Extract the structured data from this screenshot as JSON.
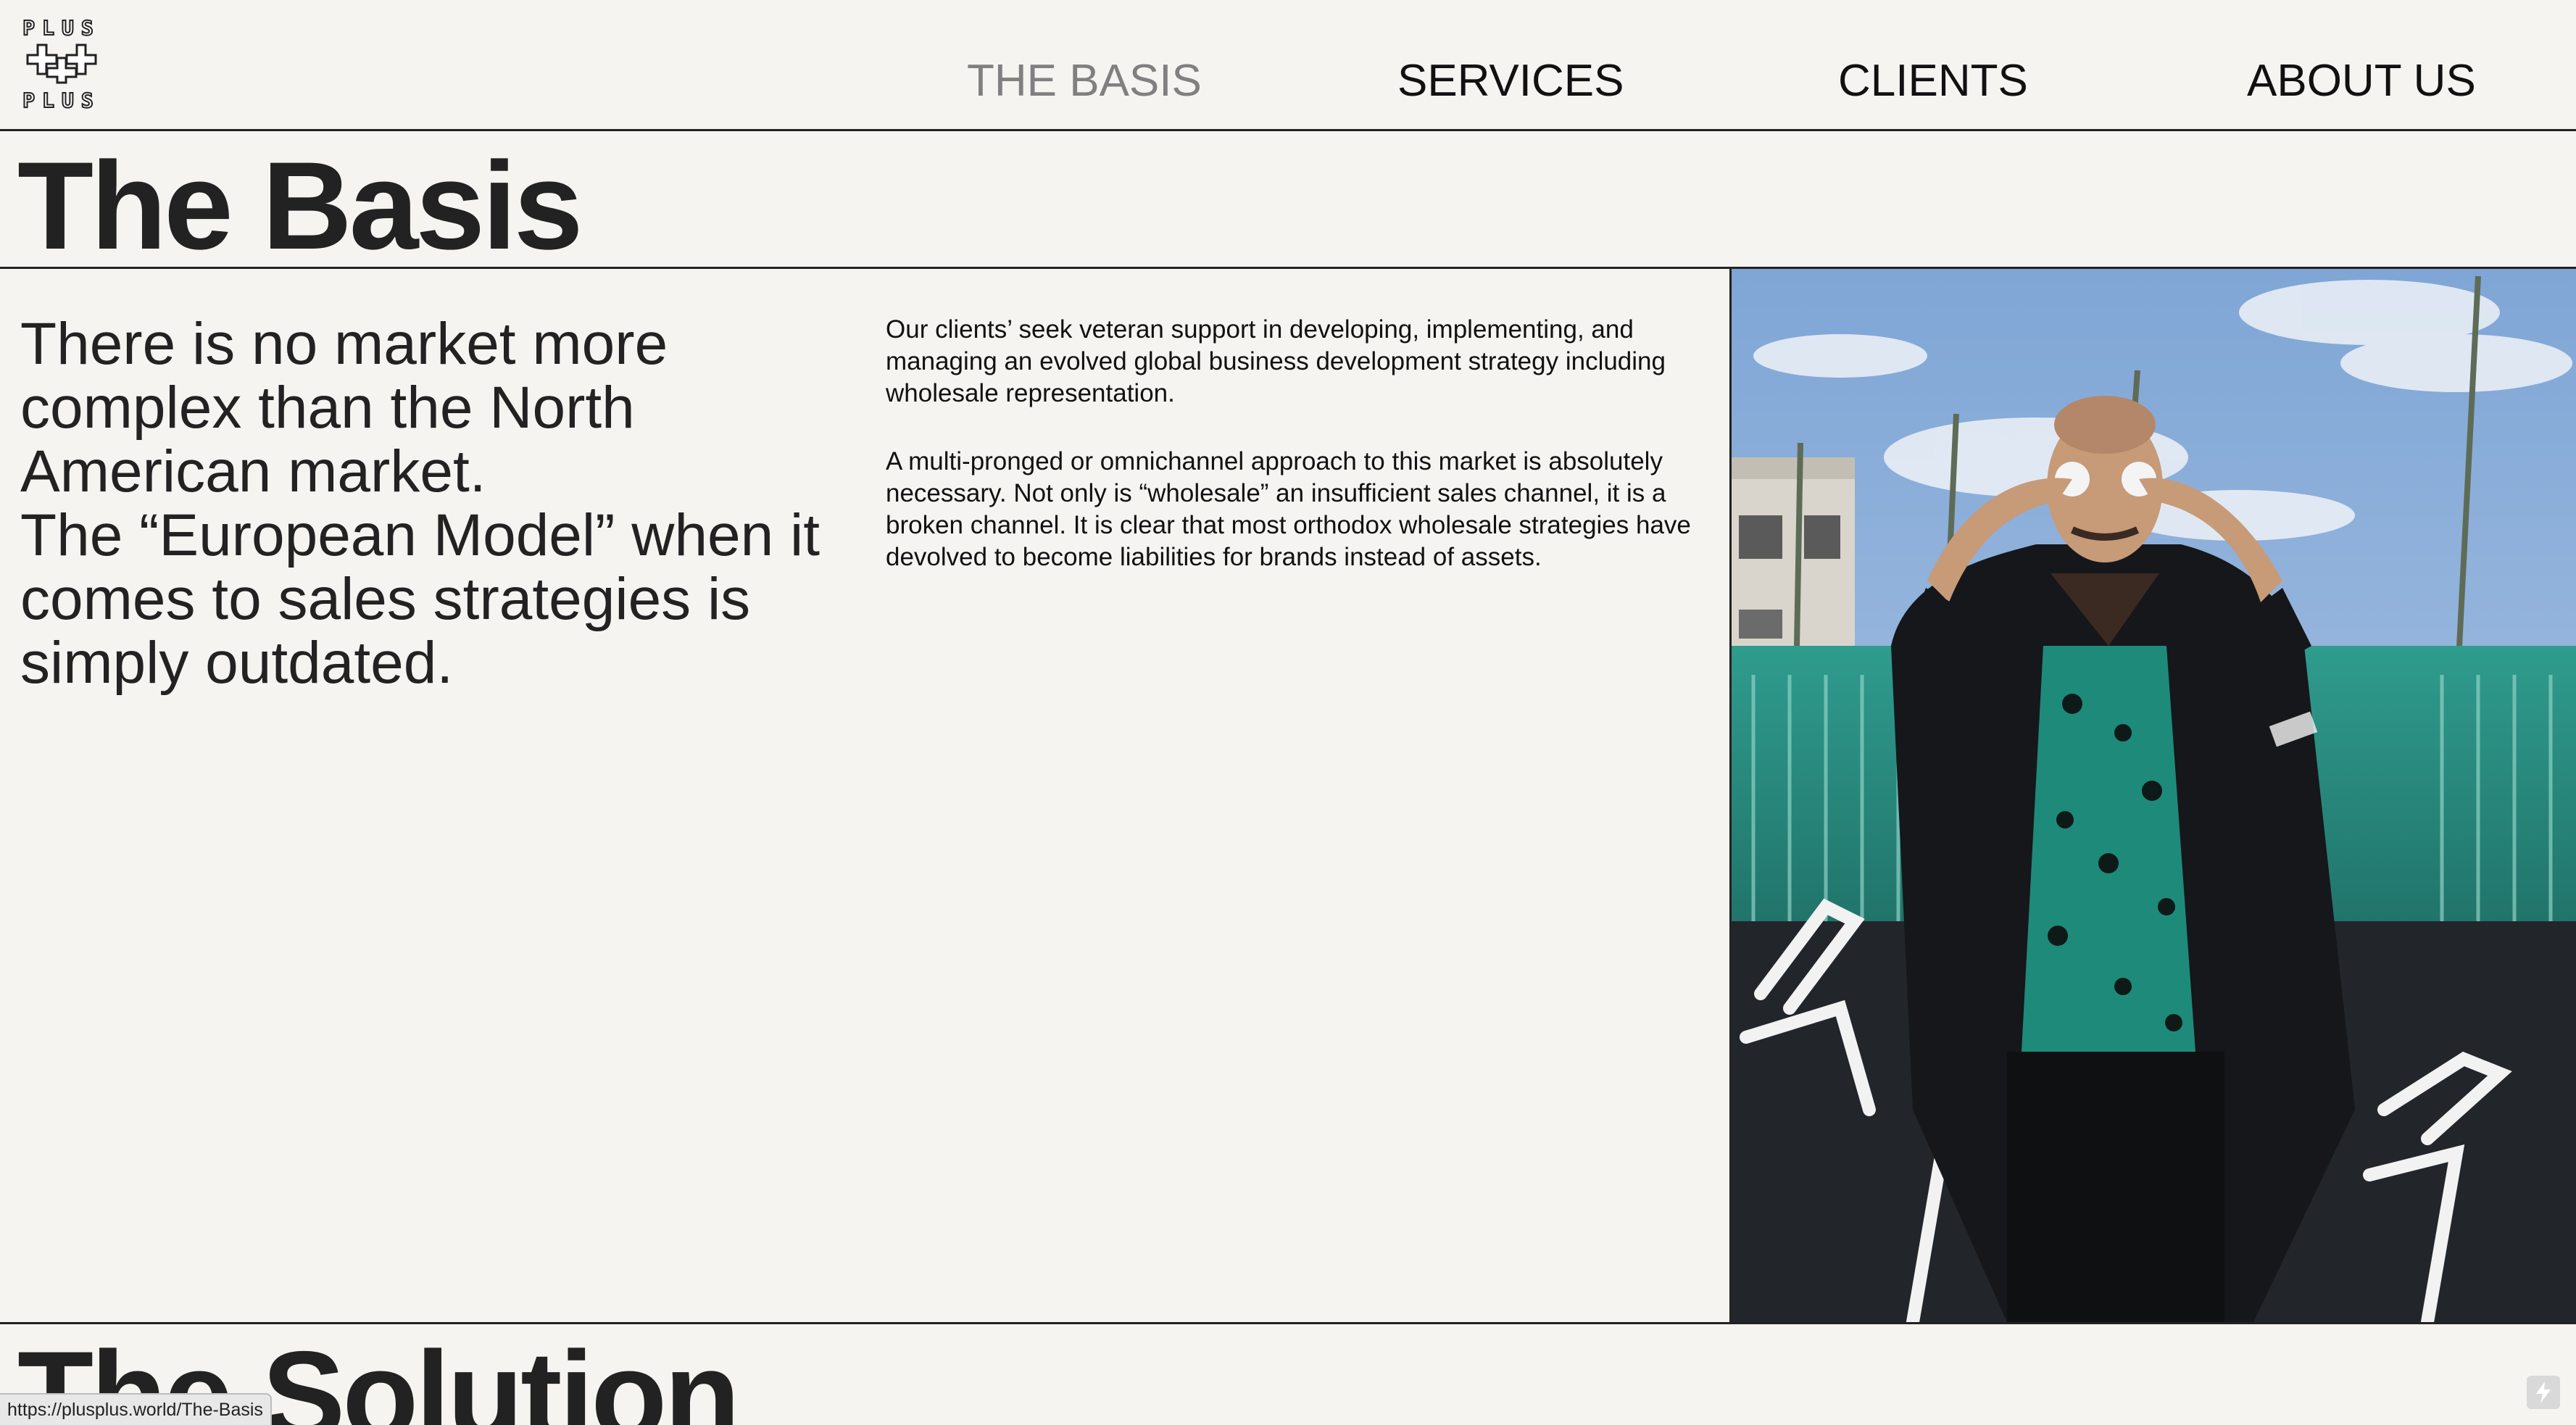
{
  "logo": {
    "top_text": "PLUS",
    "bottom_text": "PLUS",
    "icon": "double-plus-logo-icon"
  },
  "nav": {
    "items": [
      {
        "label": "THE BASIS",
        "active": true
      },
      {
        "label": "SERVICES",
        "active": false
      },
      {
        "label": "CLIENTS",
        "active": false
      },
      {
        "label": "ABOUT US",
        "active": false
      }
    ]
  },
  "page_title": "The Basis",
  "lead": {
    "paragraph_1": "There is no market more complex than the North American market.",
    "paragraph_2": "The “European Model” when it comes to sales strategies is simply outdated."
  },
  "body": {
    "paragraph_1": "Our clients’ seek veteran support in developing, implementing, and managing an evolved global business development strategy including wholesale representation.",
    "paragraph_2": "A multi-pronged or omnichannel approach to this market is absolutely necessary. Not only is “wholesale” an insufficient sales channel, it is a broken channel. It is clear that most orthodox wholesale strategies have devolved to become liabilities for brands instead of assets."
  },
  "next_section_title": "The Solution",
  "status_bar": {
    "url": "https://plusplus.world/The-Basis"
  },
  "corner_badge": {
    "icon": "lightning-icon"
  },
  "colors": {
    "background": "#f5f4f0",
    "text": "#222222",
    "nav_active": "#808080",
    "rule": "#222222"
  }
}
